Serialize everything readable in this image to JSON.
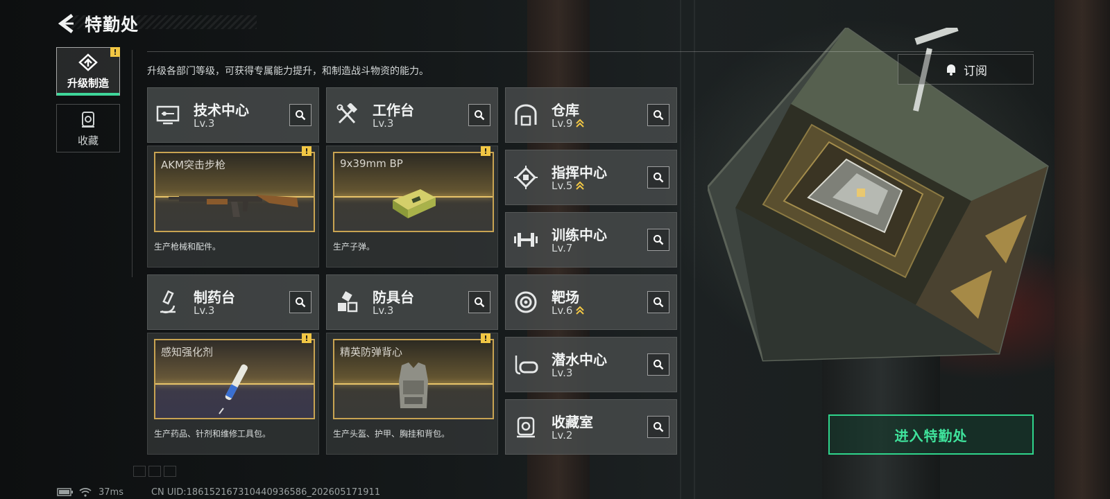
{
  "header": {
    "title": "特勤处"
  },
  "side_tabs": [
    {
      "label": "升级制造",
      "active": true,
      "alert": "!"
    },
    {
      "label": "收藏",
      "active": false
    }
  ],
  "subtitle": "升级各部门等级，可获得专属能力提升，和制造战斗物资的能力。",
  "subscribe": {
    "label": "订阅"
  },
  "facilities": {
    "tech": {
      "name": "技术中心",
      "level": "Lv.3",
      "icon": "monitor-chip-icon"
    },
    "workbench": {
      "name": "工作台",
      "level": "Lv.3",
      "icon": "hammer-wrench-icon"
    },
    "pharmacy": {
      "name": "制药台",
      "level": "Lv.3",
      "icon": "microscope-icon"
    },
    "armor": {
      "name": "防具台",
      "level": "Lv.3",
      "icon": "boxes-icon"
    },
    "warehouse": {
      "name": "仓库",
      "level": "Lv.9",
      "icon": "warehouse-icon",
      "upgrade": true
    },
    "command": {
      "name": "指挥中心",
      "level": "Lv.5",
      "icon": "chip-icon",
      "upgrade": true
    },
    "training": {
      "name": "训练中心",
      "level": "Lv.7",
      "icon": "dumbbell-icon"
    },
    "range": {
      "name": "靶场",
      "level": "Lv.6",
      "icon": "target-icon",
      "upgrade": true
    },
    "diving": {
      "name": "潜水中心",
      "level": "Lv.3",
      "icon": "diving-mask-icon"
    },
    "collection": {
      "name": "收藏室",
      "level": "Lv.2",
      "icon": "display-case-icon"
    }
  },
  "production": {
    "tech": {
      "item": "AKM突击步枪",
      "desc": "生产枪械和配件。",
      "alert": "!"
    },
    "workbench": {
      "item": "9x39mm BP",
      "desc": "生产子弹。",
      "alert": "!"
    },
    "pharmacy": {
      "item": "感知强化剂",
      "desc": "生产药品、针剂和维修工具包。",
      "alert": "!"
    },
    "armor": {
      "item": "精英防弹背心",
      "desc": "生产头盔、护甲、胸挂和背包。",
      "alert": "!"
    }
  },
  "enter_button": {
    "label": "进入特勤处"
  },
  "status": {
    "ping": "37ms",
    "uid": "CN UID:18615216731044093658​6_202605171911"
  },
  "colors": {
    "accent_green": "#3fe39c",
    "gold": "#c9a452",
    "upgrade_arrow": "#f2c744"
  }
}
